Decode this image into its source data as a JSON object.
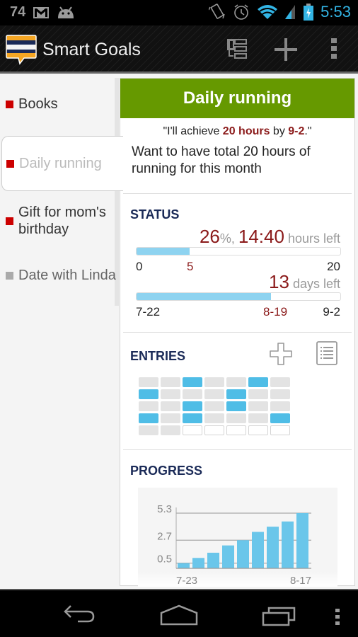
{
  "statusbar": {
    "notification_count": "74",
    "icons": [
      "gmail-icon",
      "android-icon",
      "vibrate-icon",
      "alarm-icon",
      "wifi-icon",
      "signal-icon",
      "battery-charging-icon"
    ],
    "time": "5:53",
    "accent_color": "#33b5e5"
  },
  "actionbar": {
    "title": "Smart Goals",
    "actions": [
      "hierarchy-icon",
      "add-icon",
      "overflow-menu-icon"
    ]
  },
  "sidebar": {
    "items": [
      {
        "label": "Books",
        "color": "#cc0000",
        "selected": false
      },
      {
        "label": "Daily running",
        "color": "#cc0000",
        "selected": true
      },
      {
        "label": "Gift for mom's birthday",
        "color": "#cc0000",
        "selected": false
      },
      {
        "label": "Date with Linda",
        "color": "#aaaaaa",
        "selected": false
      }
    ]
  },
  "goal": {
    "title": "Daily running",
    "header_color": "#669900",
    "quote_prefix": "\"I'll achieve ",
    "quote_amount": "20 hours",
    "quote_middle": " by ",
    "quote_date": "9-2",
    "quote_suffix": ".\"",
    "description": "Want to have total 20 hours of running for this month"
  },
  "status": {
    "title": "STATUS",
    "percent": "26",
    "percent_suffix": "%, ",
    "hours_left": "14:40",
    "hours_left_label": " hours left",
    "hours_progress_fraction": 0.26,
    "hours_min": "0",
    "hours_current": "5",
    "hours_max": "20",
    "days_left": "13",
    "days_left_label": " days left",
    "days_progress_fraction": 0.66,
    "date_start": "7-22",
    "date_current": "8-19",
    "date_end": "9-2"
  },
  "entries": {
    "title": "ENTRIES",
    "add_icon": "add-entry-icon",
    "list_icon": "list-icon",
    "grid": [
      [
        0,
        0,
        1,
        0,
        0,
        1,
        0
      ],
      [
        1,
        0,
        0,
        0,
        1,
        0,
        0
      ],
      [
        0,
        0,
        1,
        0,
        1,
        0,
        0
      ],
      [
        1,
        0,
        1,
        0,
        0,
        0,
        1
      ],
      [
        0,
        0,
        -1,
        -1,
        -1,
        -1,
        -1
      ]
    ]
  },
  "progress": {
    "title": "PROGRESS"
  },
  "chart_data": {
    "type": "bar",
    "title": "PROGRESS",
    "categories": [
      "7-23",
      "",
      "",
      "",
      "",
      "",
      "",
      "",
      "8-17"
    ],
    "x_tick_labels": [
      "7-23",
      "8-17"
    ],
    "values": [
      0.5,
      1.0,
      1.5,
      2.2,
      2.7,
      3.5,
      4.0,
      4.5,
      5.3
    ],
    "y_ticks": [
      0.5,
      2.7,
      5.3
    ],
    "ylim": [
      0,
      5.3
    ],
    "grid": true,
    "bar_color": "#6ac6ea",
    "xlabel": "",
    "ylabel": ""
  },
  "navbar": {
    "buttons": [
      "back-icon",
      "home-icon",
      "recents-icon",
      "menu-icon"
    ]
  }
}
